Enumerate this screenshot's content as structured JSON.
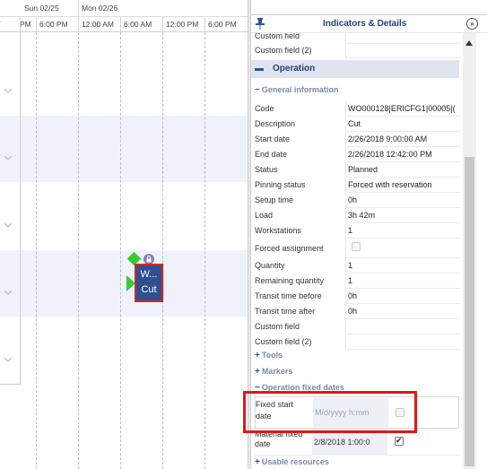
{
  "gantt": {
    "days": [
      "Sun 02/25",
      "Mon 02/26"
    ],
    "hours": [
      "PM",
      "6:00 PM",
      "12:00 AM",
      "6:00 AM",
      "12:00 PM",
      "6:00 PM"
    ],
    "left_cut": "/",
    "task": {
      "line1": "W...",
      "line2": "Cut"
    },
    "lock_glyph": "🔒"
  },
  "panel": {
    "title": "Indicators & Details",
    "collapse_glyph": "»",
    "top_rows": [
      {
        "label": "Custom field",
        "value": ""
      },
      {
        "label": "Custom field (2)",
        "value": ""
      }
    ],
    "section": "Operation",
    "general_info": "General information",
    "rows": [
      {
        "label": "Code",
        "value": "WO000128|ERICFG1|00005|("
      },
      {
        "label": "Description",
        "value": "Cut"
      },
      {
        "label": "Start date",
        "value": "2/26/2018 9:00:00 AM"
      },
      {
        "label": "End date",
        "value": "2/26/2018 12:42:00 PM"
      },
      {
        "label": "Status",
        "value": "Planned"
      },
      {
        "label": "Pinning status",
        "value": "Forced with reservation"
      },
      {
        "label": "Setup time",
        "value": "0h"
      },
      {
        "label": "Load",
        "value": "3h 42m"
      },
      {
        "label": "Workstations",
        "value": "1"
      },
      {
        "label": "Forced assignment",
        "value": ""
      },
      {
        "label": "Quantity",
        "value": "1"
      },
      {
        "label": "Remaining quantity",
        "value": "1"
      },
      {
        "label": "Transit time before",
        "value": "0h"
      },
      {
        "label": "Transit time after",
        "value": "0h"
      },
      {
        "label": "Custom field",
        "value": ""
      },
      {
        "label": "Custom field (2)",
        "value": ""
      }
    ],
    "tools": "Tools",
    "markers": "Markers",
    "fixed_dates": "Operation fixed dates",
    "fixed_start": {
      "label": "Fixed start date",
      "placeholder": "M/d/yyyy h:mm"
    },
    "material": {
      "label": "Material fixed date",
      "value": "2/8/2018 1:00:0"
    },
    "usable_resources": "Usable resources"
  }
}
